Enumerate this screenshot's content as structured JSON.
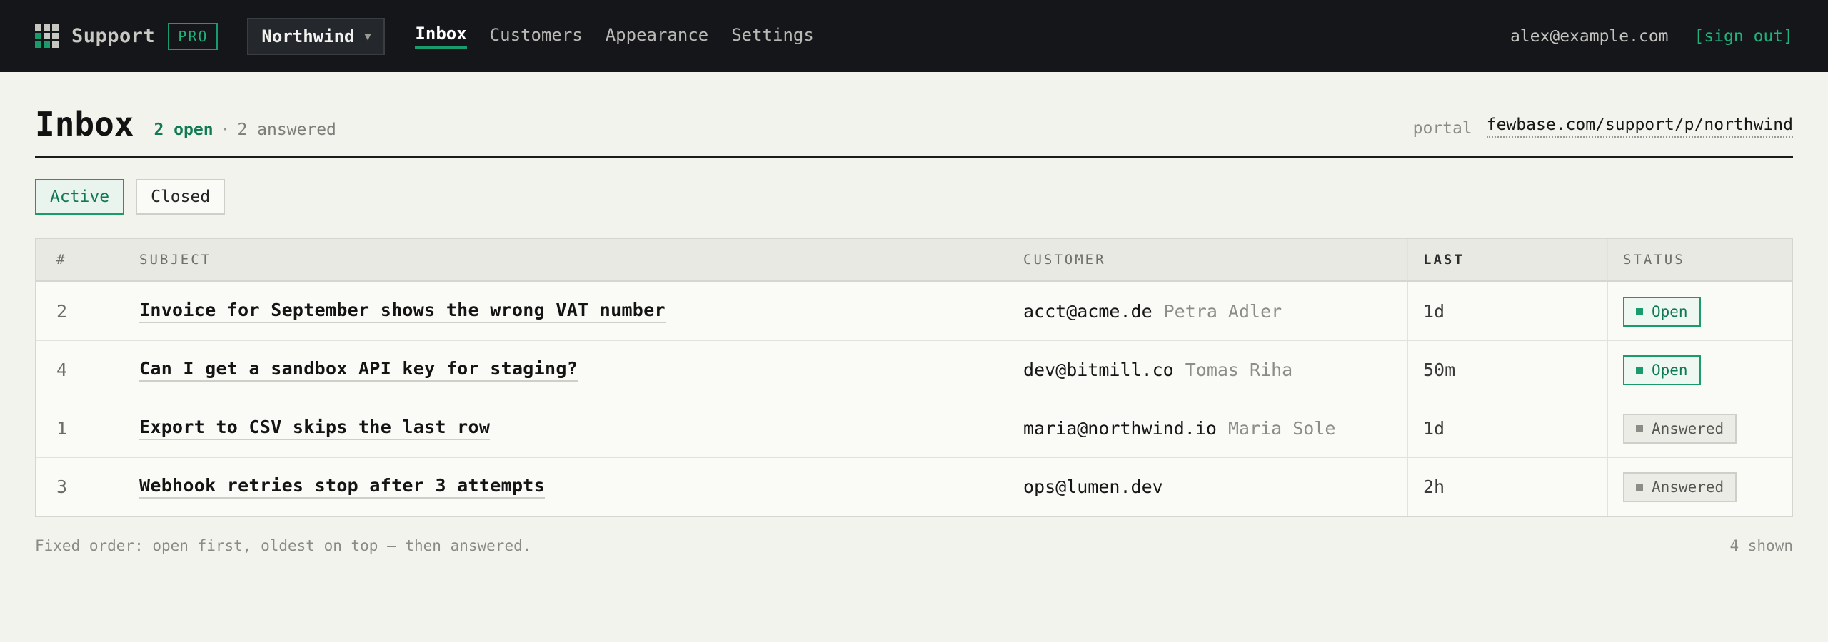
{
  "header": {
    "brand": "Support",
    "badge": "PRO",
    "org": "Northwind",
    "nav": [
      {
        "label": "Inbox",
        "active": true
      },
      {
        "label": "Customers",
        "active": false
      },
      {
        "label": "Appearance",
        "active": false
      },
      {
        "label": "Settings",
        "active": false
      }
    ],
    "user_email": "alex@example.com",
    "sign_out": "[sign out]"
  },
  "page": {
    "title": "Inbox",
    "open_count": "2 open",
    "separator": "·",
    "answered_count": "2 answered",
    "portal_label": "portal",
    "portal_url": "fewbase.com/support/p/northwind"
  },
  "tabs": [
    {
      "label": "Active",
      "active": true
    },
    {
      "label": "Closed",
      "active": false
    }
  ],
  "table": {
    "columns": [
      "#",
      "SUBJECT",
      "CUSTOMER",
      "LAST",
      "STATUS"
    ],
    "rows": [
      {
        "num": "2",
        "subject": "Invoice for September shows the wrong VAT number",
        "email": "acct@acme.de",
        "name": "Petra Adler",
        "last": "1d",
        "status": "Open",
        "status_type": "open"
      },
      {
        "num": "4",
        "subject": "Can I get a sandbox API key for staging?",
        "email": "dev@bitmill.co",
        "name": "Tomas Riha",
        "last": "50m",
        "status": "Open",
        "status_type": "open"
      },
      {
        "num": "1",
        "subject": "Export to CSV skips the last row",
        "email": "maria@northwind.io",
        "name": "Maria Sole",
        "last": "1d",
        "status": "Answered",
        "status_type": "answered"
      },
      {
        "num": "3",
        "subject": "Webhook retries stop after 3 attempts",
        "email": "ops@lumen.dev",
        "name": "",
        "last": "2h",
        "status": "Answered",
        "status_type": "answered"
      }
    ]
  },
  "footer": {
    "note": "Fixed order: open first, oldest on top — then answered.",
    "shown": "4 shown"
  },
  "colors": {
    "accent": "#1a9b6c",
    "topbar": "#141619",
    "background": "#f3f3ee"
  }
}
